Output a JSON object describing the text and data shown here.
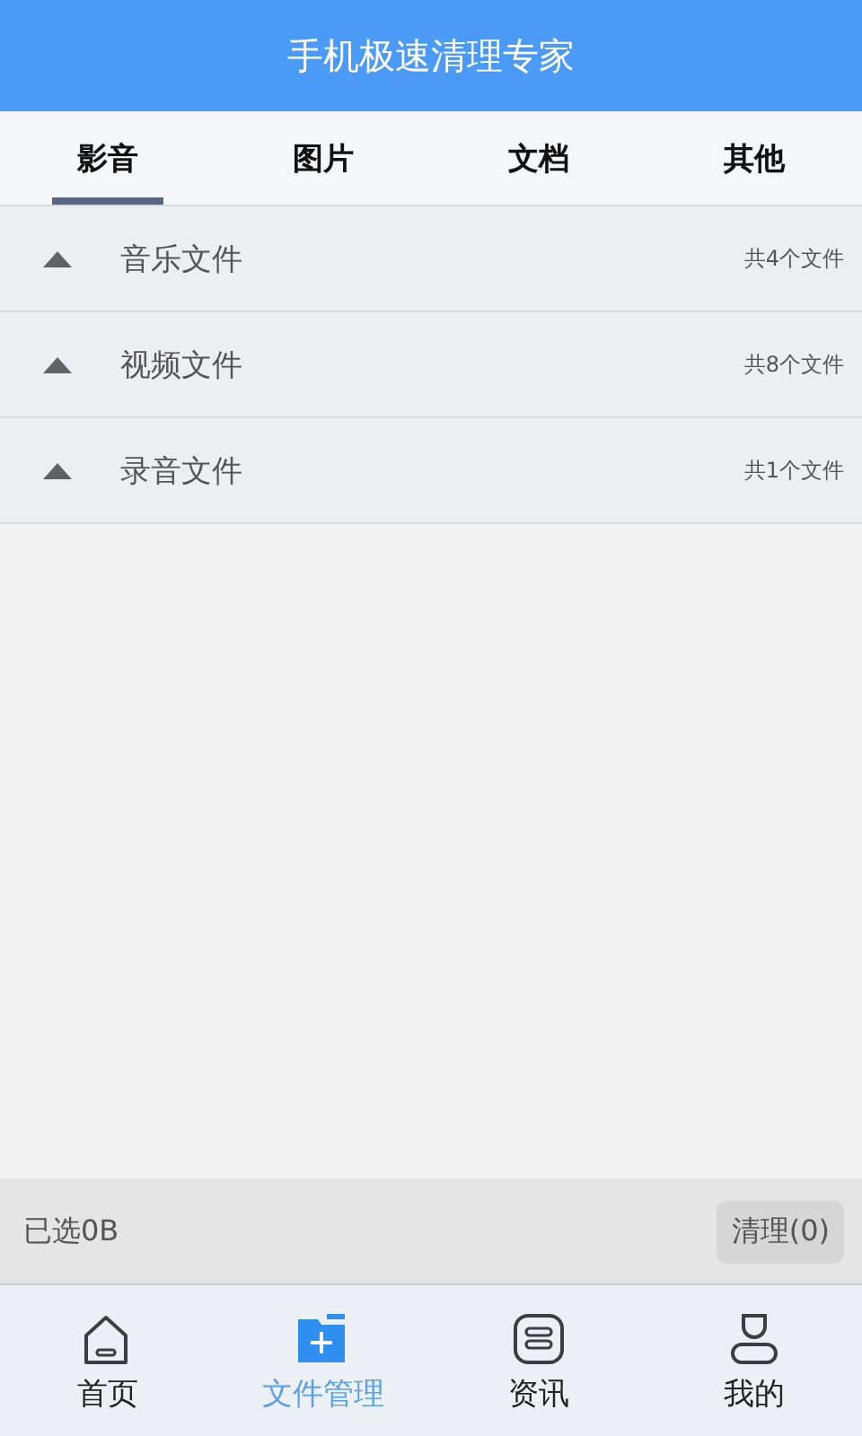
{
  "header": {
    "title": "手机极速清理专家"
  },
  "tabs": [
    {
      "label": "影音",
      "selected": true
    },
    {
      "label": "图片",
      "selected": false
    },
    {
      "label": "文档",
      "selected": false
    },
    {
      "label": "其他",
      "selected": false
    }
  ],
  "groups": [
    {
      "name": "音乐文件",
      "count": "共4个文件"
    },
    {
      "name": "视频文件",
      "count": "共8个文件"
    },
    {
      "name": "录音文件",
      "count": "共1个文件"
    }
  ],
  "action_bar": {
    "selected_size": "已选0B",
    "clean_button": "清理(0)"
  },
  "nav": [
    {
      "label": "首页",
      "kind": "home",
      "selected": false
    },
    {
      "label": "文件管理",
      "kind": "folder",
      "selected": true
    },
    {
      "label": "资讯",
      "kind": "news",
      "selected": false
    },
    {
      "label": "我的",
      "kind": "profile",
      "selected": false
    }
  ]
}
